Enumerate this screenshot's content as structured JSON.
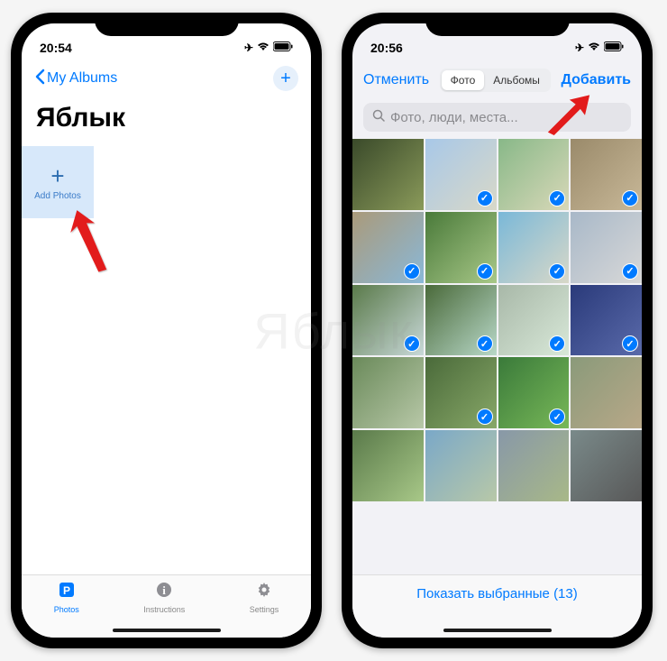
{
  "watermark": "Яблык",
  "phone1": {
    "time": "20:54",
    "back_label": "My Albums",
    "album_title": "Яблык",
    "add_tile_label": "Add Photos",
    "tabs": [
      {
        "label": "Photos",
        "active": true
      },
      {
        "label": "Instructions",
        "active": false
      },
      {
        "label": "Settings",
        "active": false
      }
    ]
  },
  "phone2": {
    "time": "20:56",
    "cancel": "Отменить",
    "seg_photo": "Фото",
    "seg_albums": "Альбомы",
    "add": "Добавить",
    "search_placeholder": "Фото, люди, места...",
    "selected_count": 13,
    "show_selected_label": "Показать выбранные (13)",
    "thumbs": [
      {
        "name": "cave-interior",
        "c1": "#3a4a2a",
        "c2": "#8a9a5a",
        "selected": false
      },
      {
        "name": "white-mansion",
        "c1": "#a8c8e8",
        "c2": "#d8d8c8",
        "selected": true
      },
      {
        "name": "church-pillars",
        "c1": "#88b888",
        "c2": "#d8d8b8",
        "selected": true
      },
      {
        "name": "stone-arch",
        "c1": "#9a8a6a",
        "c2": "#c8b898",
        "selected": true
      },
      {
        "name": "castle-ruins",
        "c1": "#aa9a7a",
        "c2": "#8ab8d8",
        "selected": true
      },
      {
        "name": "green-valley",
        "c1": "#4a7a3a",
        "c2": "#a8c888",
        "selected": true
      },
      {
        "name": "church-tower",
        "c1": "#7ab8d8",
        "c2": "#d8d8c8",
        "selected": true
      },
      {
        "name": "neoclassical",
        "c1": "#a8b8c8",
        "c2": "#d8d8d8",
        "selected": true
      },
      {
        "name": "waterfall-1",
        "c1": "#5a7a4a",
        "c2": "#c8d8d8",
        "selected": true
      },
      {
        "name": "waterfall-2",
        "c1": "#4a6a3a",
        "c2": "#b8d8c8",
        "selected": true
      },
      {
        "name": "waterfall-mist",
        "c1": "#a8b8a8",
        "c2": "#d8e8d8",
        "selected": true
      },
      {
        "name": "blue-building-night",
        "c1": "#2a3a7a",
        "c2": "#5a6aaa",
        "selected": true
      },
      {
        "name": "cliff-view",
        "c1": "#6a8a5a",
        "c2": "#b8c8a8",
        "selected": false
      },
      {
        "name": "mountain-valley",
        "c1": "#4a6a3a",
        "c2": "#88a868",
        "selected": true
      },
      {
        "name": "hiker-green",
        "c1": "#3a7a3a",
        "c2": "#78b858",
        "selected": true
      },
      {
        "name": "hillside-town",
        "c1": "#8a9a7a",
        "c2": "#b8a888",
        "selected": false
      },
      {
        "name": "mountain-meadow",
        "c1": "#5a7a4a",
        "c2": "#a8c888",
        "selected": false
      },
      {
        "name": "coastal-road",
        "c1": "#7aa8c8",
        "c2": "#b8c8a8",
        "selected": false
      },
      {
        "name": "church-hill",
        "c1": "#8898a8",
        "c2": "#a8b888",
        "selected": false
      },
      {
        "name": "parked-car",
        "c1": "#7a8a8a",
        "c2": "#585858",
        "selected": false
      }
    ]
  }
}
